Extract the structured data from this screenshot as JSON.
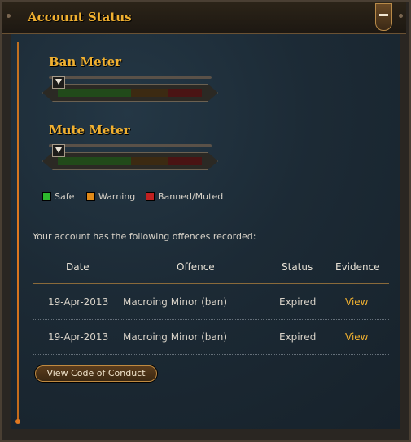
{
  "panel": {
    "title": "Account Status"
  },
  "meters": [
    {
      "label": "Ban Meter",
      "level": 0
    },
    {
      "label": "Mute Meter",
      "level": 0
    }
  ],
  "legend": [
    {
      "label": "Safe",
      "color": "#2db82d"
    },
    {
      "label": "Warning",
      "color": "#e08a18"
    },
    {
      "label": "Banned/Muted",
      "color": "#c02020"
    }
  ],
  "offences": {
    "intro": "Your account has the following offences recorded:",
    "headers": [
      "Date",
      "Offence",
      "Status",
      "Evidence"
    ],
    "rows": [
      {
        "date": "19-Apr-2013",
        "offence": "Macroing Minor (ban)",
        "status": "Expired",
        "evidence": "View"
      },
      {
        "date": "19-Apr-2013",
        "offence": "Macroing Minor (ban)",
        "status": "Expired",
        "evidence": "View"
      }
    ]
  },
  "actions": {
    "code_of_conduct": "View Code of Conduct"
  },
  "colors": {
    "accent": "#f0b030",
    "line": "#e07820"
  }
}
